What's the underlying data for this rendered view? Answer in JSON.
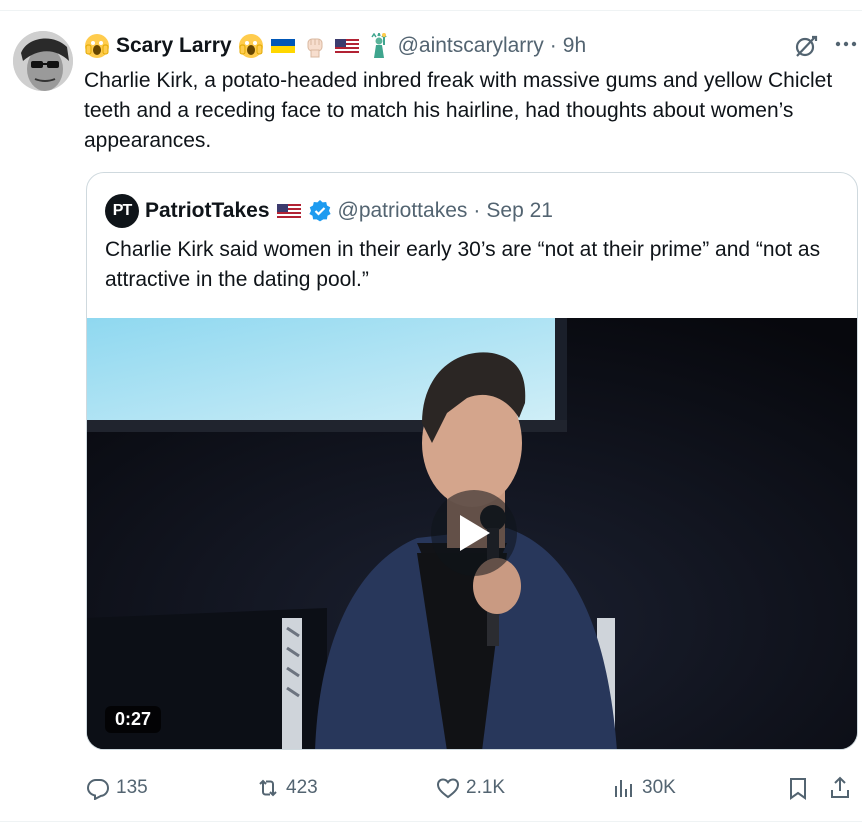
{
  "tweet": {
    "display_name": "Scary Larry",
    "handle": "@aintscarylarry",
    "separator": "·",
    "time": "9h",
    "text": "Charlie Kirk, a potato-headed inbred freak with massive gums and yellow Chiclet teeth and a receding face to match his hairline, had thoughts about women’s appearances.",
    "emojis": [
      "scream-emoji",
      "ukraine-flag",
      "raised-fist-emoji",
      "us-flag",
      "statue-of-liberty-emoji"
    ]
  },
  "quote": {
    "avatar_text": "PT",
    "display_name": "PatriotTakes",
    "handle": "@patriottakes",
    "separator": "·",
    "time": "Sep 21",
    "text": "Charlie Kirk said women in their early 30’s are “not at their prime” and “not as attractive in the dating pool.”",
    "video": {
      "duration": "0:27"
    }
  },
  "actions": {
    "replies": "135",
    "reposts": "423",
    "likes": "2.1K",
    "views": "30K"
  },
  "colors": {
    "secondary_text": "#536471",
    "verified": "#1d9bf0",
    "border": "#cfd9de"
  }
}
